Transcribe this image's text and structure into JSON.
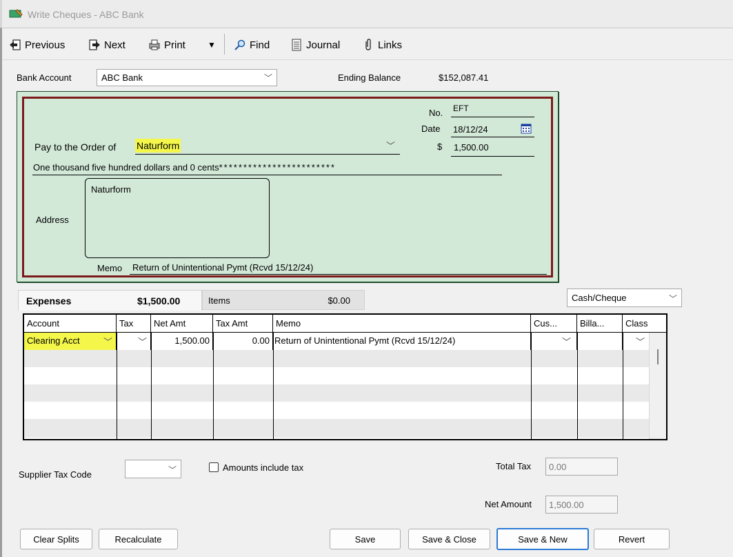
{
  "window": {
    "title": "Write Cheques - ABC Bank"
  },
  "toolbar": {
    "previous": "Previous",
    "next": "Next",
    "print": "Print",
    "find": "Find",
    "journal": "Journal",
    "links": "Links"
  },
  "header": {
    "bank_account_label": "Bank Account",
    "bank_account_value": "ABC Bank",
    "ending_balance_label": "Ending Balance",
    "ending_balance_value": "$152,087.41"
  },
  "cheque": {
    "no_label": "No.",
    "no_value": "EFT",
    "date_label": "Date",
    "date_value": "18/12/24",
    "pay_to_label": "Pay to the Order of",
    "payee": "Naturform",
    "currency_symbol": "$",
    "amount": "1,500.00",
    "amount_words": "One thousand five hundred dollars and 0 cents",
    "amount_fill": "************************",
    "address_label": "Address",
    "address_text": "Naturform",
    "memo_label": "Memo",
    "memo_value": "Return of Unintentional Pymt (Rcvd 15/12/24)"
  },
  "tabs": {
    "expenses_label": "Expenses",
    "expenses_total": "$1,500.00",
    "items_label": "Items",
    "items_total": "$0.00",
    "payment_method": "Cash/Cheque"
  },
  "grid": {
    "columns": [
      "Account",
      "Tax",
      "Net Amt",
      "Tax Amt",
      "Memo",
      "Cus...",
      "Billa...",
      "Class"
    ],
    "rows": [
      {
        "account": "Clearing Acct",
        "tax": "",
        "net_amt": "1,500.00",
        "tax_amt": "0.00",
        "memo": "Return of Unintentional Pymt (Rcvd 15/12/24)",
        "customer": "",
        "billable": "",
        "class": ""
      }
    ]
  },
  "footer": {
    "supplier_tax_code_label": "Supplier Tax Code",
    "amounts_include_tax_label": "Amounts include tax",
    "total_tax_label": "Total Tax",
    "total_tax_value": "0.00",
    "net_amount_label": "Net Amount",
    "net_amount_value": "1,500.00"
  },
  "buttons": {
    "clear_splits": "Clear Splits",
    "recalculate": "Recalculate",
    "save": "Save",
    "save_close": "Save & Close",
    "save_new": "Save & New",
    "revert": "Revert"
  },
  "colors": {
    "cheque_bg": "#d3e9d8",
    "cheque_border": "#7c1a1a",
    "highlight": "#f4f74a",
    "primary_button_border": "#2b7ad6"
  }
}
